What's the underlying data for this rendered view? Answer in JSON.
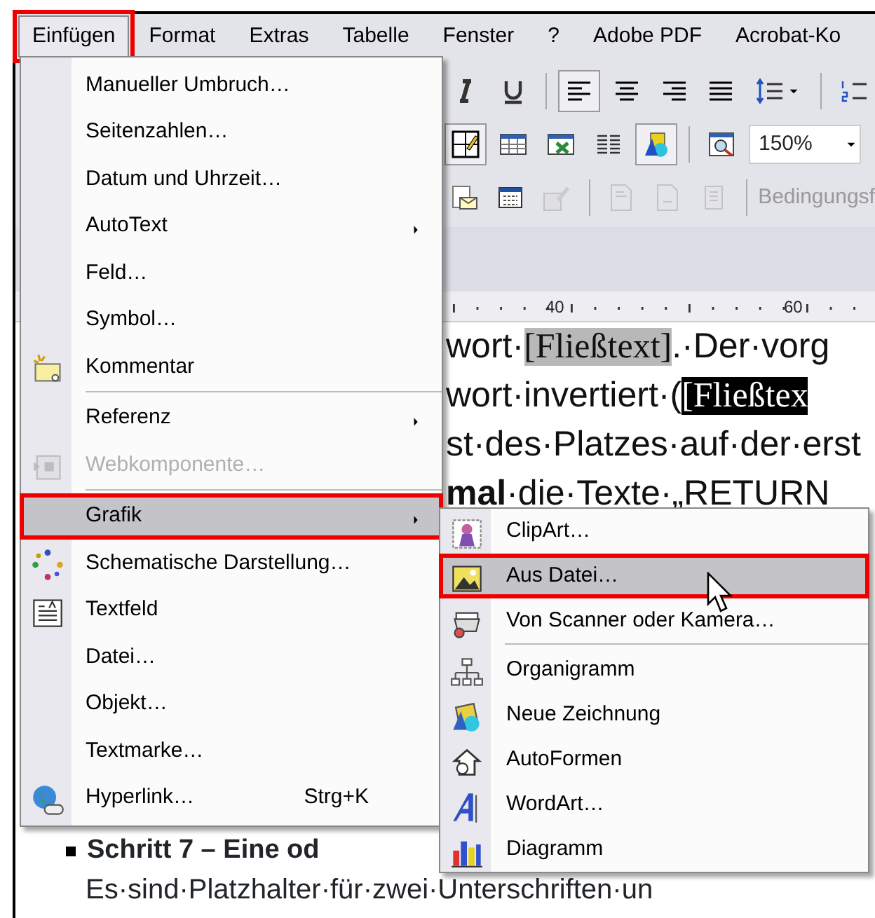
{
  "menu_bar": [
    {
      "label": "Einfügen",
      "selected": true
    },
    {
      "label": "Format",
      "selected": false
    },
    {
      "label": "Extras",
      "selected": false
    },
    {
      "label": "Tabelle",
      "selected": false
    },
    {
      "label": "Fenster",
      "selected": false
    },
    {
      "label": "?",
      "selected": false
    },
    {
      "label": "Adobe PDF",
      "selected": false
    },
    {
      "label": "Acrobat-Ko",
      "selected": false
    }
  ],
  "toolbar": {
    "row_1": [
      {
        "pressed": false
      },
      {
        "pressed": false
      },
      {
        "pressed": true
      },
      {
        "pressed": false
      },
      {
        "pressed": false
      },
      {
        "pressed": false
      },
      {
        "pressed": false
      },
      {
        "pressed": false
      }
    ],
    "row_2": [
      {
        "pressed": true
      },
      {
        "pressed": false
      },
      {
        "pressed": false
      },
      {
        "pressed": false
      },
      {
        "pressed": true
      },
      {
        "pressed": false
      }
    ],
    "zoom_field": {
      "value": "150%"
    },
    "row_3": [
      {
        "disabled": false
      },
      {
        "disabled": false
      },
      {
        "disabled": true
      },
      {
        "disabled": true
      },
      {
        "disabled": true
      },
      {
        "disabled": true
      }
    ],
    "label": "Bedingungsf"
  },
  "ruler": {
    "labels": [
      "40",
      "60"
    ]
  },
  "document": {
    "lines": [
      {
        "segments": [
          {
            "text": "wort·"
          },
          {
            "text": "[Fließtext]",
            "kind": "field"
          },
          {
            "text": ".·Der·vorg"
          }
        ]
      },
      {
        "segments": [
          {
            "text": "wort·invertiert·("
          },
          {
            "text": "[Fließtex",
            "kind": "inverted"
          }
        ]
      },
      {
        "segments": [
          {
            "text": "st·des·Platzes·auf·der·erst"
          }
        ]
      },
      {
        "segments": [
          {
            "text": "mal",
            "kind": "bold"
          },
          {
            "text": "·die·Texte·„RETURN"
          }
        ]
      }
    ],
    "heading": "Schritt 7 – Eine od",
    "paragraph": "Es·sind·Platzhalter·für·zwei·Unterschriften·un"
  },
  "insert_menu": [
    {
      "kind": "item",
      "label": "Manueller Umbruch…",
      "submenu": false,
      "disabled": false,
      "selected": false
    },
    {
      "kind": "item",
      "label": "Seitenzahlen…",
      "submenu": false,
      "disabled": false,
      "selected": false
    },
    {
      "kind": "item",
      "label": "Datum und Uhrzeit…",
      "submenu": false,
      "disabled": false,
      "selected": false
    },
    {
      "kind": "item",
      "label": "AutoText",
      "submenu": true,
      "disabled": false,
      "selected": false
    },
    {
      "kind": "item",
      "label": "Feld…",
      "submenu": false,
      "disabled": false,
      "selected": false
    },
    {
      "kind": "item",
      "label": "Symbol…",
      "submenu": false,
      "disabled": false,
      "selected": false
    },
    {
      "kind": "item",
      "label": "Kommentar",
      "submenu": false,
      "disabled": false,
      "selected": false
    },
    {
      "kind": "separator"
    },
    {
      "kind": "item",
      "label": "Referenz",
      "submenu": true,
      "disabled": false,
      "selected": false
    },
    {
      "kind": "item",
      "label": "Webkomponente…",
      "submenu": false,
      "disabled": true,
      "selected": false
    },
    {
      "kind": "separator"
    },
    {
      "kind": "item",
      "label": "Grafik",
      "submenu": true,
      "disabled": false,
      "selected": true
    },
    {
      "kind": "item",
      "label": "Schematische Darstellung…",
      "submenu": false,
      "disabled": false,
      "selected": false
    },
    {
      "kind": "item",
      "label": "Textfeld",
      "submenu": false,
      "disabled": false,
      "selected": false
    },
    {
      "kind": "item",
      "label": "Datei…",
      "submenu": false,
      "disabled": false,
      "selected": false
    },
    {
      "kind": "item",
      "label": "Objekt…",
      "submenu": false,
      "disabled": false,
      "selected": false
    },
    {
      "kind": "item",
      "label": "Textmarke…",
      "submenu": false,
      "disabled": false,
      "selected": false
    },
    {
      "kind": "item",
      "label": "Hyperlink…",
      "shortcut": "Strg+K",
      "submenu": false,
      "disabled": false,
      "selected": false
    }
  ],
  "graphic_submenu": [
    {
      "kind": "item",
      "label": "ClipArt…",
      "selected": false
    },
    {
      "kind": "item",
      "label": "Aus Datei…",
      "selected": true
    },
    {
      "kind": "item",
      "label": "Von Scanner oder Kamera…",
      "selected": false
    },
    {
      "kind": "separator"
    },
    {
      "kind": "item",
      "label": "Organigramm",
      "selected": false
    },
    {
      "kind": "item",
      "label": "Neue Zeichnung",
      "selected": false
    },
    {
      "kind": "item",
      "label": "AutoFormen",
      "selected": false
    },
    {
      "kind": "item",
      "label": "WordArt…",
      "selected": false
    },
    {
      "kind": "item",
      "label": "Diagramm",
      "selected": false
    }
  ]
}
